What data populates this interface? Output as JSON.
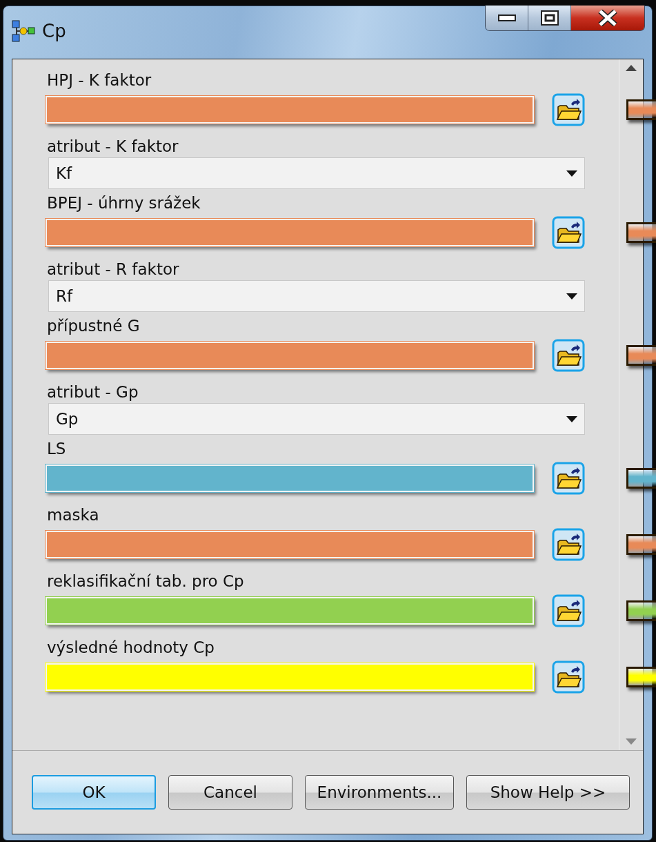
{
  "window": {
    "title": "Cp"
  },
  "parameters": [
    {
      "kind": "file",
      "label": "HPJ - K faktor",
      "color": "#e88a58"
    },
    {
      "kind": "dropdown",
      "label": "atribut - K faktor",
      "value": "Kf"
    },
    {
      "kind": "file",
      "label": "BPEJ - úhrny srážek",
      "color": "#e88a58"
    },
    {
      "kind": "dropdown",
      "label": "atribut - R faktor",
      "value": "Rf"
    },
    {
      "kind": "file",
      "label": "přípustné G",
      "color": "#e88a58"
    },
    {
      "kind": "dropdown",
      "label": "atribut - Gp",
      "value": "Gp"
    },
    {
      "kind": "file",
      "label": "LS",
      "color": "#62b4cc"
    },
    {
      "kind": "file",
      "label": "maska",
      "color": "#e88a58"
    },
    {
      "kind": "file",
      "label": "reklasifikační tab. pro Cp",
      "color": "#92d050"
    },
    {
      "kind": "file",
      "label": "výsledné hodnoty Cp",
      "color": "#ffff00"
    }
  ],
  "buttons": [
    {
      "label": "OK",
      "default": true
    },
    {
      "label": "Cancel",
      "default": false
    },
    {
      "label": "Environments...",
      "default": false
    },
    {
      "label": "Show Help >>",
      "default": false
    }
  ]
}
